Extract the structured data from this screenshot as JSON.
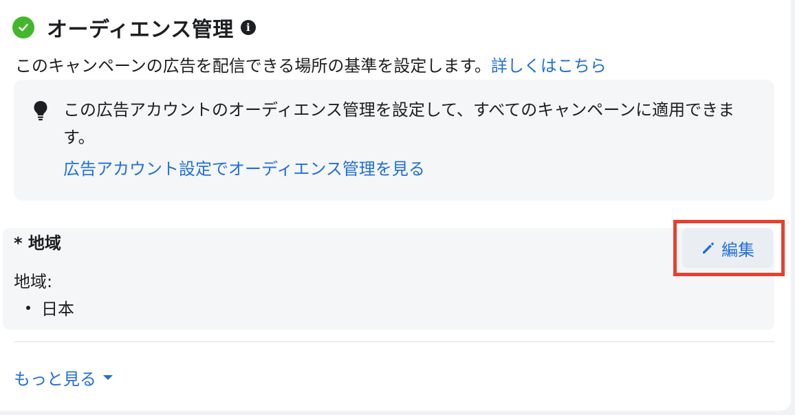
{
  "section": {
    "title": "オーディエンス管理",
    "description": "このキャンペーンの広告を配信できる場所の基準を設定します。",
    "learn_more_link": "詳しくはこちら"
  },
  "tip": {
    "text": "この広告アカウントのオーディエンス管理を設定して、すべてのキャンペーンに適用できます。",
    "link": "広告アカウント設定でオーディエンス管理を見る"
  },
  "region": {
    "title": "* 地域",
    "label": "地域:",
    "items": [
      "日本"
    ],
    "edit_label": "編集"
  },
  "footer": {
    "more_label": "もっと見る"
  },
  "colors": {
    "accent": "#216fdb",
    "success": "#42b72a",
    "highlight": "#e8402f"
  }
}
